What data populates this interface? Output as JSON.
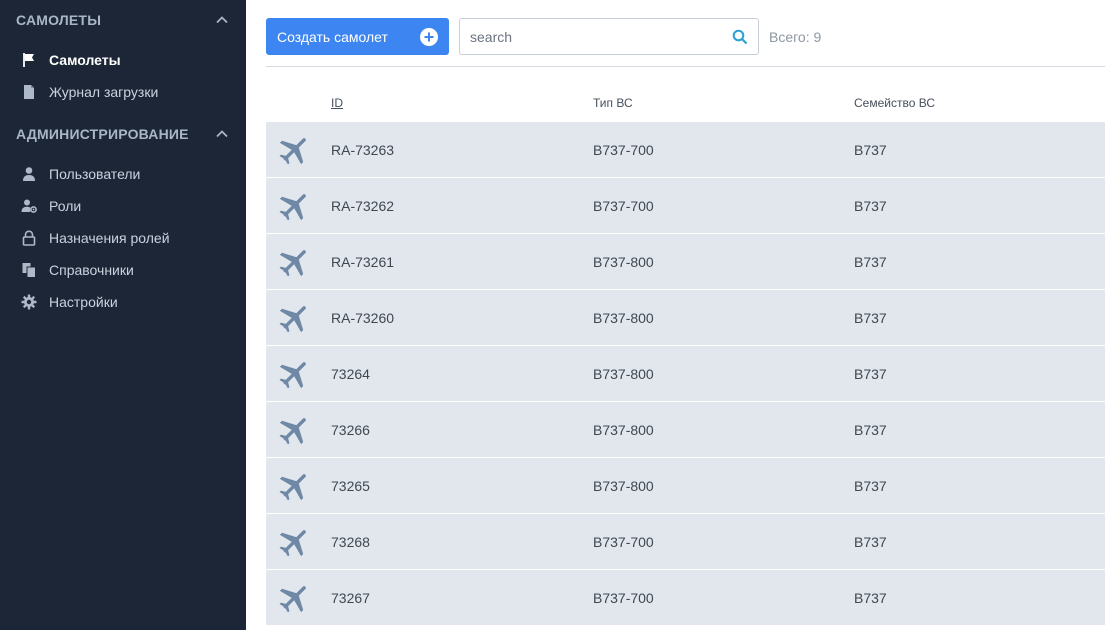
{
  "sidebar": {
    "sections": [
      {
        "title": "САМОЛЕТЫ",
        "items": [
          {
            "label": "Самолеты",
            "icon": "flag-icon",
            "active": true
          },
          {
            "label": "Журнал загрузки",
            "icon": "document-icon",
            "active": false
          }
        ]
      },
      {
        "title": "АДМИНИСТРИРОВАНИЕ",
        "items": [
          {
            "label": "Пользователи",
            "icon": "user-icon",
            "active": false
          },
          {
            "label": "Роли",
            "icon": "user-gear-icon",
            "active": false
          },
          {
            "label": "Назначения ролей",
            "icon": "lock-icon",
            "active": false
          },
          {
            "label": "Справочники",
            "icon": "copy-icon",
            "active": false
          },
          {
            "label": "Настройки",
            "icon": "gear-icon",
            "active": false
          }
        ]
      }
    ]
  },
  "toolbar": {
    "create_label": "Создать самолет",
    "search_placeholder": "search",
    "search_value": "",
    "total_text": "Всего: 9"
  },
  "table": {
    "headers": {
      "id": "ID",
      "type": "Тип ВС",
      "family": "Семейство ВС"
    },
    "rows": [
      {
        "id": "RA-73263",
        "type": "B737-700",
        "family": "B737"
      },
      {
        "id": "RA-73262",
        "type": "B737-700",
        "family": "B737"
      },
      {
        "id": "RA-73261",
        "type": "B737-800",
        "family": "B737"
      },
      {
        "id": "RA-73260",
        "type": "B737-800",
        "family": "B737"
      },
      {
        "id": "73264",
        "type": "B737-800",
        "family": "B737"
      },
      {
        "id": "73266",
        "type": "B737-800",
        "family": "B737"
      },
      {
        "id": "73265",
        "type": "B737-800",
        "family": "B737"
      },
      {
        "id": "73268",
        "type": "B737-700",
        "family": "B737"
      },
      {
        "id": "73267",
        "type": "B737-700",
        "family": "B737"
      }
    ]
  },
  "colors": {
    "sidebar_bg": "#1d2636",
    "accent": "#3d85f0",
    "row_bg": "#e2e7ee",
    "plane_icon": "#6f88a6"
  }
}
